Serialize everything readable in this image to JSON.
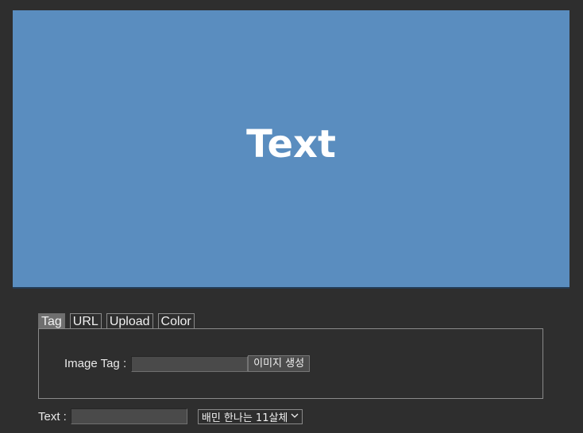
{
  "preview": {
    "text": "Text",
    "background": "#5a8dbf",
    "text_color": "#ffffff"
  },
  "tabs": [
    {
      "label": "Tag",
      "active": true
    },
    {
      "label": "URL",
      "active": false
    },
    {
      "label": "Upload",
      "active": false
    },
    {
      "label": "Color",
      "active": false
    }
  ],
  "tag_panel": {
    "label": "Image Tag :",
    "value": "",
    "button_label": "이미지 생성"
  },
  "text_field": {
    "label": "Text :",
    "value": ""
  },
  "font_select": {
    "selected": "배민 한나는 11살체",
    "icon": "chevron-down-icon"
  }
}
